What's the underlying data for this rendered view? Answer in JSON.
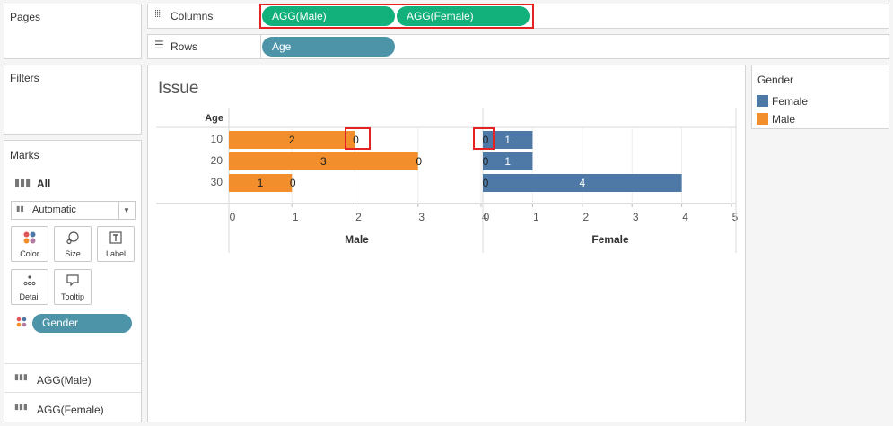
{
  "left_panel": {
    "pages_title": "Pages",
    "filters_title": "Filters",
    "marks_title": "Marks",
    "marks_all_label": "All",
    "mark_type": "Automatic",
    "buttons": {
      "color": "Color",
      "size": "Size",
      "label": "Label",
      "detail": "Detail",
      "tooltip": "Tooltip"
    },
    "gender_pill": "Gender",
    "measures": [
      "AGG(Male)",
      "AGG(Female)"
    ]
  },
  "shelves": {
    "columns_label": "Columns",
    "columns_pills": [
      "AGG(Male)",
      "AGG(Female)"
    ],
    "rows_label": "Rows",
    "rows_pills": [
      "Age"
    ]
  },
  "view": {
    "title": "Issue",
    "row_header": "Age"
  },
  "legend": {
    "title": "Gender",
    "items": [
      {
        "label": "Female",
        "color": "#4e79a7"
      },
      {
        "label": "Male",
        "color": "#f28e2b"
      }
    ]
  },
  "chart_data": {
    "type": "bar",
    "categories": [
      "10",
      "20",
      "30"
    ],
    "panels": [
      {
        "name": "Male",
        "xlabel": "Male",
        "xlim": [
          0,
          4
        ],
        "ticks": [
          "0",
          "1",
          "2",
          "3",
          "4"
        ],
        "color": "#f28e2b",
        "values": [
          2,
          3,
          1
        ],
        "inner_labels": [
          "2",
          "3",
          "1"
        ],
        "end_labels": [
          "0",
          "0",
          "0"
        ]
      },
      {
        "name": "Female",
        "xlabel": "Female",
        "xlim": [
          0,
          5
        ],
        "ticks": [
          "0",
          "1",
          "2",
          "3",
          "4",
          "5"
        ],
        "color": "#4e79a7",
        "values": [
          1,
          1,
          4
        ],
        "inner_labels": [
          "1",
          "1",
          "4"
        ],
        "start_labels": [
          "0",
          "0",
          "0"
        ]
      }
    ]
  }
}
